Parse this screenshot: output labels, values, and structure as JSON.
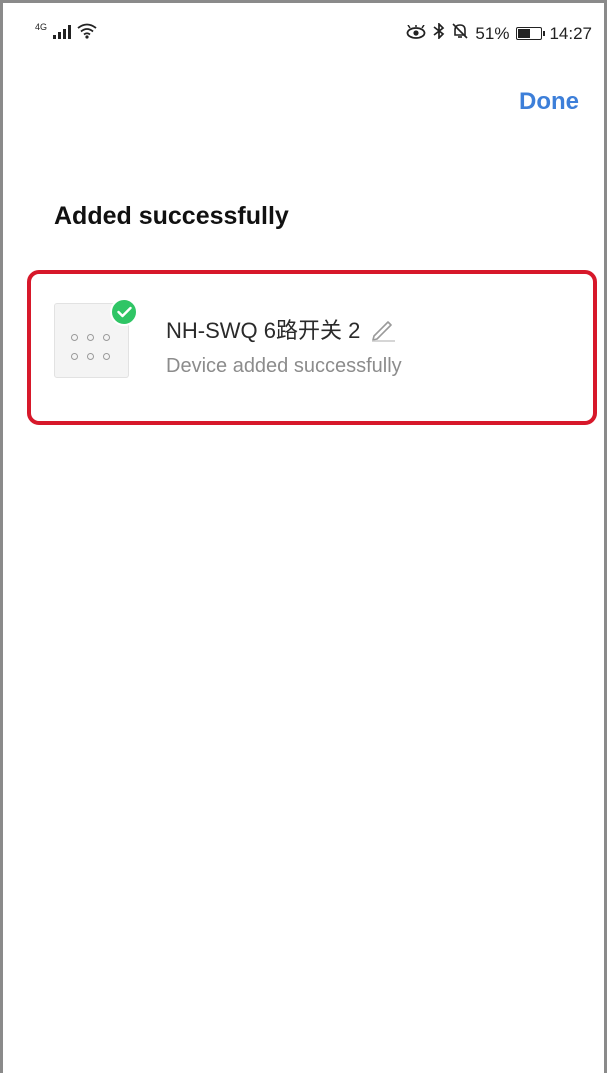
{
  "status_bar": {
    "network_type": "4G",
    "battery_percent": "51%",
    "time": "14:27",
    "icons": [
      "signal-icon",
      "wifi-icon",
      "eye-icon",
      "bluetooth-icon",
      "bell-off-icon",
      "battery-icon"
    ]
  },
  "header": {
    "done_label": "Done"
  },
  "main": {
    "title": "Added successfully",
    "device": {
      "name": "NH-SWQ 6路开关 2",
      "status": "Device added successfully"
    }
  },
  "colors": {
    "accent": "#3d7fd9",
    "success": "#2fc565",
    "highlight": "#d7182a"
  }
}
